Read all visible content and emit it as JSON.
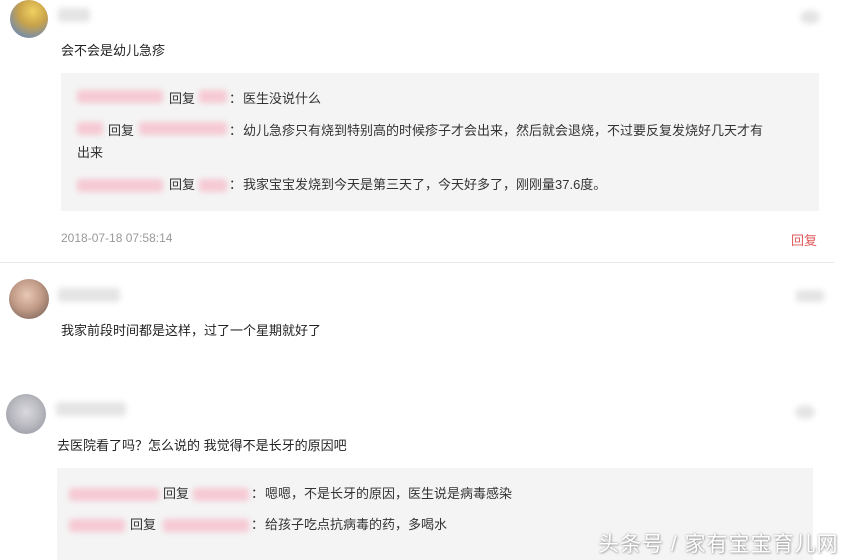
{
  "comments": [
    {
      "text": "会不会是幼儿急疹",
      "replies": [
        {
          "reply_word": "回复",
          "sep": "：",
          "text": "医生没说什么"
        },
        {
          "reply_word": "回复",
          "sep": "：",
          "text": "幼儿急疹只有烧到特别高的时候疹子才会出来，然后就会退烧，不过要反复发烧好几天才有",
          "text2": "出来"
        },
        {
          "reply_word": "回复",
          "sep": "：",
          "text": "我家宝宝发烧到今天是第三天了，今天好多了，刚刚量37.6度。"
        }
      ],
      "timestamp": "2018-07-18 07:58:14",
      "reply_action": "回复"
    },
    {
      "text": "我家前段时间都是这样，过了一个星期就好了"
    },
    {
      "text": "去医院看了吗？怎么说的 我觉得不是长牙的原因吧",
      "replies": [
        {
          "reply_word": "回复",
          "sep": "：",
          "text": "嗯嗯，不是长牙的原因，医生说是病毒感染"
        },
        {
          "reply_word": "回复",
          "sep": "：",
          "text": "给孩子吃点抗病毒的药，多喝水"
        }
      ]
    }
  ],
  "watermark": "头条号 / 家有宝宝育儿网",
  "colors": {
    "accent": "#e05a5a",
    "reply_bg": "#f4f4f4",
    "meta": "#999999"
  }
}
